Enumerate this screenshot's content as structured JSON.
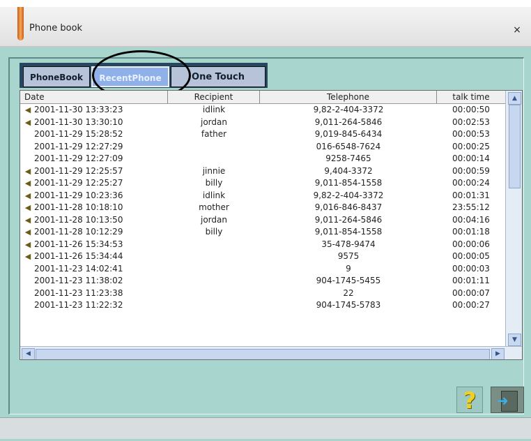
{
  "window": {
    "title": "Phone book",
    "close_label": "×"
  },
  "tabs": [
    "PhoneBook",
    "RecentPhone",
    "One Touch"
  ],
  "columns": [
    "Date",
    "Recipient",
    "Telephone",
    "talk time"
  ],
  "rows": [
    {
      "icon": true,
      "date": "2001-11-30 13:33:23",
      "recipient": "idlink",
      "telephone": "9,82-2-404-3372",
      "talk_time": "00:00:50"
    },
    {
      "icon": true,
      "date": "2001-11-30 13:30:10",
      "recipient": "jordan",
      "telephone": "9,011-264-5846",
      "talk_time": "00:02:53"
    },
    {
      "icon": false,
      "date": "2001-11-29 15:28:52",
      "recipient": "father",
      "telephone": "9,019-845-6434",
      "talk_time": "00:00:53"
    },
    {
      "icon": false,
      "date": "2001-11-29 12:27:29",
      "recipient": "",
      "telephone": "016-6548-7624",
      "talk_time": "00:00:25"
    },
    {
      "icon": false,
      "date": "2001-11-29 12:27:09",
      "recipient": "",
      "telephone": "9258-7465",
      "talk_time": "00:00:14"
    },
    {
      "icon": true,
      "date": "2001-11-29 12:25:57",
      "recipient": "jinnie",
      "telephone": "9,404-3372",
      "talk_time": "00:00:59"
    },
    {
      "icon": true,
      "date": "2001-11-29 12:25:27",
      "recipient": "billy",
      "telephone": "9,011-854-1558",
      "talk_time": "00:00:24"
    },
    {
      "icon": true,
      "date": "2001-11-29 10:23:36",
      "recipient": "idlink",
      "telephone": "9,82-2-404-3372",
      "talk_time": "00:01:31"
    },
    {
      "icon": true,
      "date": "2001-11-28 10:18:10",
      "recipient": "mother",
      "telephone": "9,016-846-8437",
      "talk_time": "23:55:12"
    },
    {
      "icon": true,
      "date": "2001-11-28 10:13:50",
      "recipient": "jordan",
      "telephone": "9,011-264-5846",
      "talk_time": "00:04:16"
    },
    {
      "icon": true,
      "date": "2001-11-28 10:12:29",
      "recipient": "billy",
      "telephone": "9,011-854-1558",
      "talk_time": "00:01:18"
    },
    {
      "icon": true,
      "date": "2001-11-26 15:34:53",
      "recipient": "",
      "telephone": "35-478-9474",
      "talk_time": "00:00:06"
    },
    {
      "icon": true,
      "date": "2001-11-26 15:34:44",
      "recipient": "",
      "telephone": "9575",
      "talk_time": "00:00:05"
    },
    {
      "icon": false,
      "date": "2001-11-23 14:02:41",
      "recipient": "",
      "telephone": "9",
      "talk_time": "00:00:03"
    },
    {
      "icon": false,
      "date": "2001-11-23 11:38:02",
      "recipient": "",
      "telephone": "904-1745-5455",
      "talk_time": "00:01:11"
    },
    {
      "icon": false,
      "date": "2001-11-23 11:23:38",
      "recipient": "",
      "telephone": "22",
      "talk_time": "00:00:07"
    },
    {
      "icon": false,
      "date": "2001-11-23 11:22:32",
      "recipient": "",
      "telephone": "904-1745-5783",
      "talk_time": "00:00:27"
    }
  ],
  "buttons": {
    "help_label": "?"
  },
  "icons": {
    "call": "speaker-icon",
    "help": "question-mark-icon",
    "exit": "exit-door-icon"
  }
}
